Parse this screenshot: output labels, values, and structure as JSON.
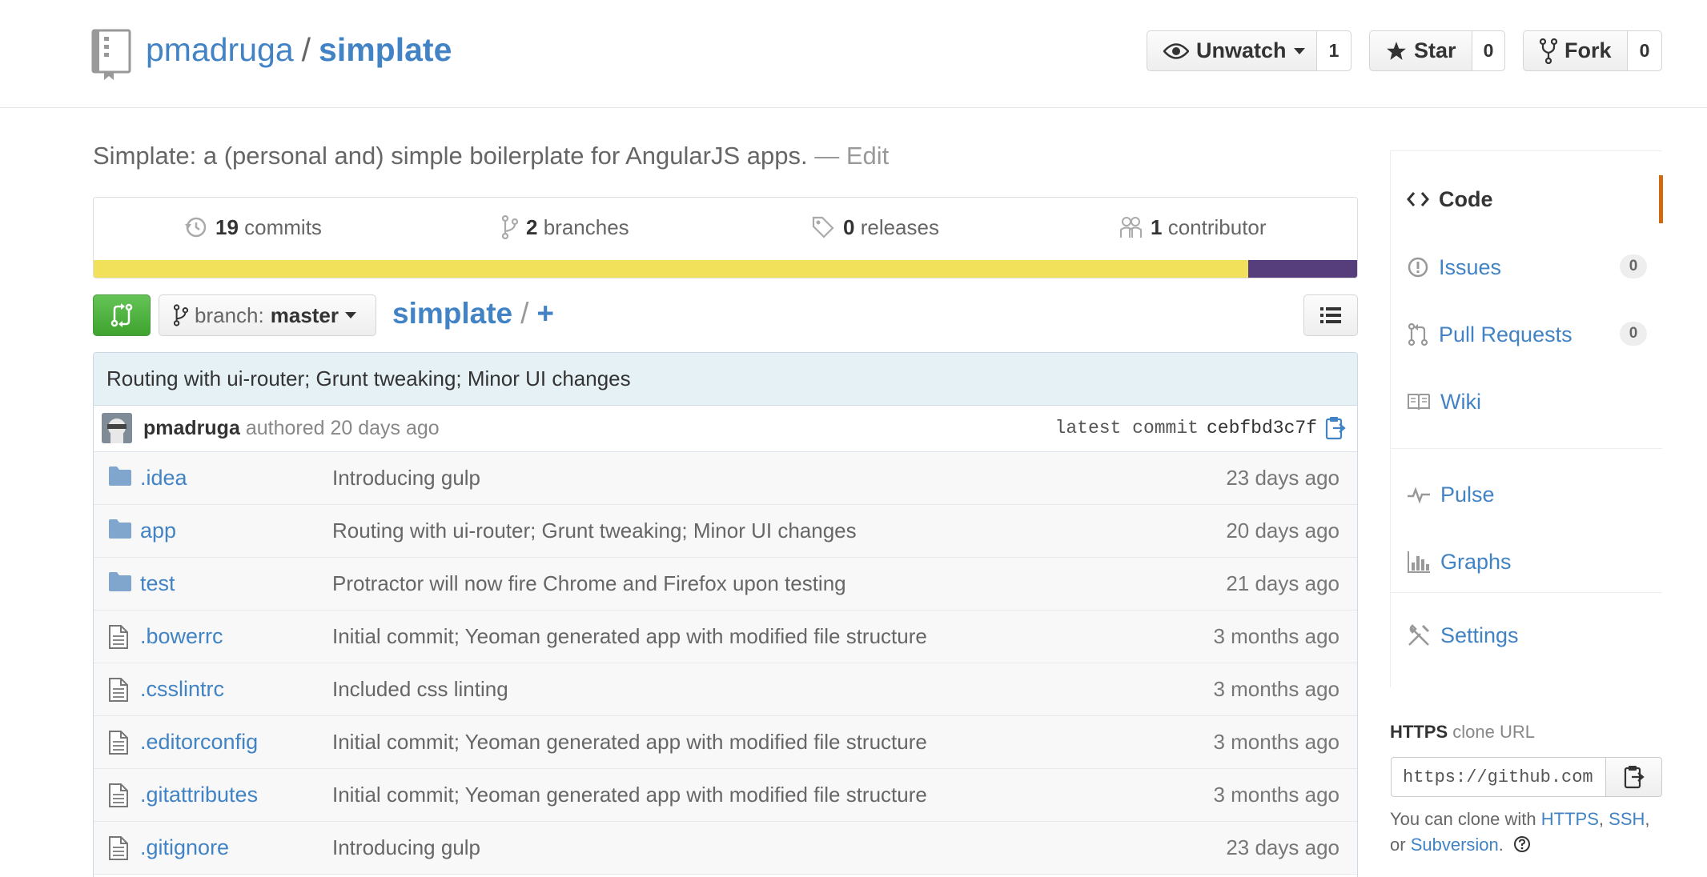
{
  "repo": {
    "owner": "pmadruga",
    "separator": "/",
    "name": "simplate",
    "description": "Simplate: a (personal and) simple boilerplate for AngularJS apps.",
    "edit_label": "— Edit"
  },
  "actions": {
    "watch": {
      "label": "Unwatch",
      "count": "1"
    },
    "star": {
      "label": "Star",
      "count": "0"
    },
    "fork": {
      "label": "Fork",
      "count": "0"
    }
  },
  "summary": {
    "commits": {
      "count": "19",
      "label": "commits"
    },
    "branches": {
      "count": "2",
      "label": "branches"
    },
    "releases": {
      "count": "0",
      "label": "releases"
    },
    "contributors": {
      "count": "1",
      "label": "contributor"
    }
  },
  "languages": [
    {
      "color": "#f1e05a",
      "percent": 91.4
    },
    {
      "color": "#563d7c",
      "percent": 8.6
    }
  ],
  "file_nav": {
    "branch_prefix": "branch:",
    "branch": "master",
    "breadcrumb_root": "simplate",
    "breadcrumb_sep": "/",
    "breadcrumb_add": "+"
  },
  "latest_commit": {
    "message": "Routing with ui-router; Grunt tweaking; Minor UI changes",
    "author": "pmadruga",
    "authored_text": "authored 20 days ago",
    "sha_label": "latest commit",
    "sha": "cebfbd3c7f"
  },
  "files": [
    {
      "type": "dir",
      "name": ".idea",
      "message": "Introducing gulp",
      "age": "23 days ago"
    },
    {
      "type": "dir",
      "name": "app",
      "message": "Routing with ui-router; Grunt tweaking; Minor UI changes",
      "age": "20 days ago"
    },
    {
      "type": "dir",
      "name": "test",
      "message": "Protractor will now fire Chrome and Firefox upon testing",
      "age": "21 days ago"
    },
    {
      "type": "file",
      "name": ".bowerrc",
      "message": "Initial commit; Yeoman generated app with modified file structure",
      "age": "3 months ago"
    },
    {
      "type": "file",
      "name": ".csslintrc",
      "message": "Included css linting",
      "age": "3 months ago"
    },
    {
      "type": "file",
      "name": ".editorconfig",
      "message": "Initial commit; Yeoman generated app with modified file structure",
      "age": "3 months ago"
    },
    {
      "type": "file",
      "name": ".gitattributes",
      "message": "Initial commit; Yeoman generated app with modified file structure",
      "age": "3 months ago"
    },
    {
      "type": "file",
      "name": ".gitignore",
      "message": "Introducing gulp",
      "age": "23 days ago"
    }
  ],
  "sidebar": {
    "code": "Code",
    "issues": {
      "label": "Issues",
      "count": "0"
    },
    "pulls": {
      "label": "Pull Requests",
      "count": "0"
    },
    "wiki": "Wiki",
    "pulse": "Pulse",
    "graphs": "Graphs",
    "settings": "Settings",
    "accent_color": "#d26911"
  },
  "clone": {
    "protocol": "HTTPS",
    "label": "clone URL",
    "url": "https://github.com/pmadruga/simplate.git",
    "help_prefix": "You can clone with",
    "https": "HTTPS",
    "comma1": ",",
    "ssh": "SSH",
    "comma_or": ", or",
    "subversion": "Subversion",
    "period": "."
  }
}
